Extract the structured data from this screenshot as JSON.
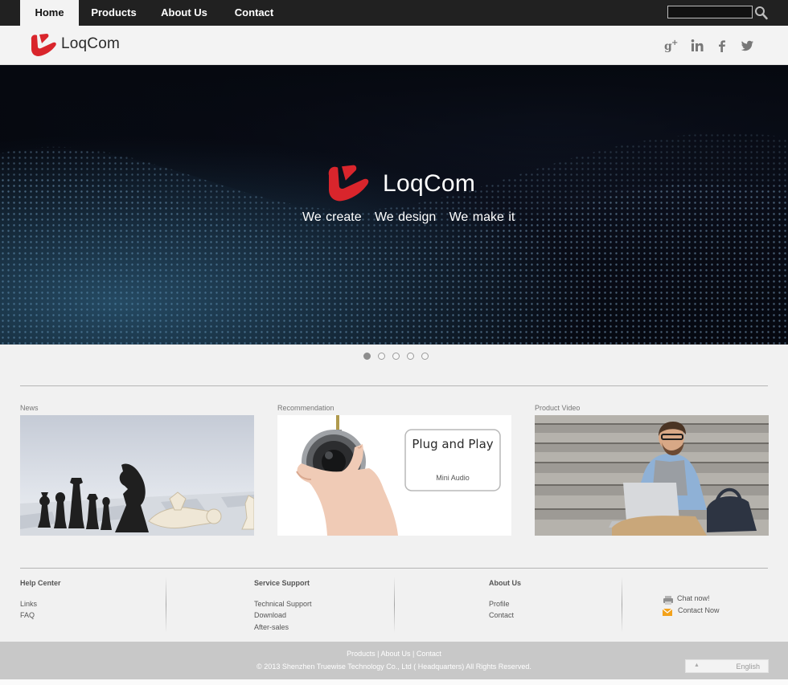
{
  "nav": {
    "items": [
      {
        "label": "Home",
        "active": true
      },
      {
        "label": "Products",
        "active": false
      },
      {
        "label": "About Us",
        "active": false
      },
      {
        "label": "Contact",
        "active": false
      }
    ],
    "search": {
      "value": "",
      "icon": "search-icon"
    }
  },
  "brand": {
    "logo_text": "LoqCom",
    "social": [
      "google-plus-icon",
      "linkedin-icon",
      "facebook-icon",
      "twitter-icon"
    ]
  },
  "hero": {
    "logo_text": "LoqCom",
    "tagline": "We create   We design   We make it",
    "slide_count": 5,
    "active_slide": 1
  },
  "panels": [
    {
      "title": "News"
    },
    {
      "title": "Recommendation",
      "card_title": "Plug and Play",
      "card_subtitle": "Mini Audio"
    },
    {
      "title": "Product Video"
    }
  ],
  "footer": {
    "columns": [
      {
        "heading": "Help Center",
        "links": [
          "Links",
          "FAQ"
        ]
      },
      {
        "heading": "Service Support",
        "links": [
          "Technical Support",
          "Download",
          "After-sales"
        ]
      },
      {
        "heading": "About Us",
        "links": [
          "Profile",
          "Contact"
        ]
      }
    ],
    "contact": [
      {
        "label": "Chat now!",
        "icon": "chat-icon"
      },
      {
        "label": "Contact Now",
        "icon": "mail-icon"
      }
    ]
  },
  "bottom": {
    "links": [
      "Products",
      "About Us",
      "Contact"
    ],
    "copyright": "© 2013 Shenzhen Truewise Technology Co., Ltd ( Headquarters) All Rights Reserved.",
    "language": "English"
  },
  "colors": {
    "brand_red": "#d9252c",
    "nav_bg": "#212121",
    "footer_bar": "#c8c8c8"
  }
}
